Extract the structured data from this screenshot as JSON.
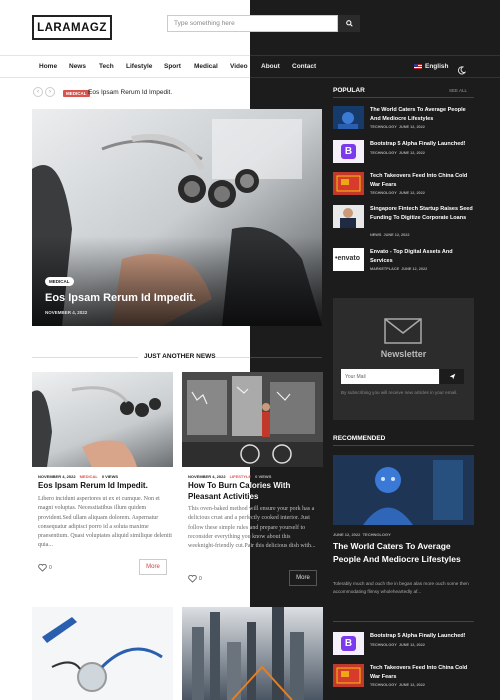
{
  "header": {
    "logo": "LARAMAGZ",
    "search_placeholder": "Type something here"
  },
  "nav": {
    "items": [
      "Home",
      "News",
      "Tech",
      "Lifestyle",
      "Sport",
      "Medical",
      "Video",
      "About",
      "Contact"
    ],
    "language": "English"
  },
  "ticker": {
    "badge": "Medical",
    "headline": "Eos Ipsam Rerum Id Impedit."
  },
  "hero": {
    "badge": "MEDICAL",
    "title": "Eos Ipsam Rerum Id Impedit.",
    "date": "NOVEMBER 4, 2022"
  },
  "popular": {
    "title": "POPULAR",
    "see_all": "SEE ALL",
    "items": [
      {
        "title": "The World Caters To Average People And Mediocre Lifestyles",
        "category": "TECHNOLOGY",
        "date": "JUNE 12, 2022"
      },
      {
        "title": "Bootstrap 5 Alpha Finally Launched!",
        "category": "TECHNOLOGY",
        "date": "JUNE 12, 2022"
      },
      {
        "title": "Tech Takeovers Feed Into China Cold War Fears",
        "category": "TECHNOLOGY",
        "date": "JUNE 12, 2022"
      },
      {
        "title": "Singapore Fintech Startup Raises Seed Funding To Digitize Corporate Loans",
        "category": "NEWS",
        "date": "JUNE 12, 2022"
      },
      {
        "title": "Envato - Top Digital Assets And Services",
        "category": "MARKETPLACE",
        "date": "JUNE 12, 2022"
      }
    ]
  },
  "newsletter": {
    "title": "Newsletter",
    "placeholder": "Your Mail",
    "description": "By subscribing you will receive new articles in your email."
  },
  "just_another_news": {
    "title": "JUST ANOTHER NEWS",
    "cards": [
      {
        "date": "NOVEMBER 4, 2022",
        "category": "MEDICAL",
        "views": "0 VIEWS",
        "title": "Eos Ipsam Rerum Id Impedit.",
        "excerpt": "Libero incidunt asperiores ut ex et cumque. Non et magni voluptas. Necessitatibus illum quidem provident.Sed ullam aliquam dolorem. Aspernatur consequatur adipisci porro id a soluta maxime praesentium. Quasi voluptates aliquid similique deleniti quia...",
        "likes": "0",
        "more": "More"
      },
      {
        "date": "NOVEMBER 4, 2022",
        "category": "LIFESTYLE",
        "views": "0 VIEWS",
        "title": "How To Burn Calories With Pleasant Activities",
        "excerpt": "This oven-baked method will ensure your pork has a delicious crust and a perfectly cooked interior. Just follow these simple rules and prepare yourself to reconsider everything you know about this weeknight-friendly cut.Pair this delicious dish with...",
        "likes": "0",
        "more": "More"
      }
    ]
  },
  "recommended": {
    "title": "RECOMMENDED",
    "date": "JUNE 12, 2022",
    "category": "TECHNOLOGY",
    "headline": "The World Caters To Average People And Mediocre Lifestyles",
    "excerpt": "Tolerably much and ouch the in began alas more ouch some then accommodating flimsy wholeheartedly af...",
    "items": [
      {
        "title": "Bootstrap 5 Alpha Finally Launched!",
        "category": "TECHNOLOGY",
        "date": "JUNE 12, 2022"
      },
      {
        "title": "Tech Takeovers Feed Into China Cold War Fears",
        "category": "TECHNOLOGY",
        "date": "JUNE 12, 2022"
      }
    ]
  },
  "colors": {
    "accent": "#d9534f",
    "dark_bg": "#1c1c1c",
    "panel_bg": "#2c2c2c"
  }
}
